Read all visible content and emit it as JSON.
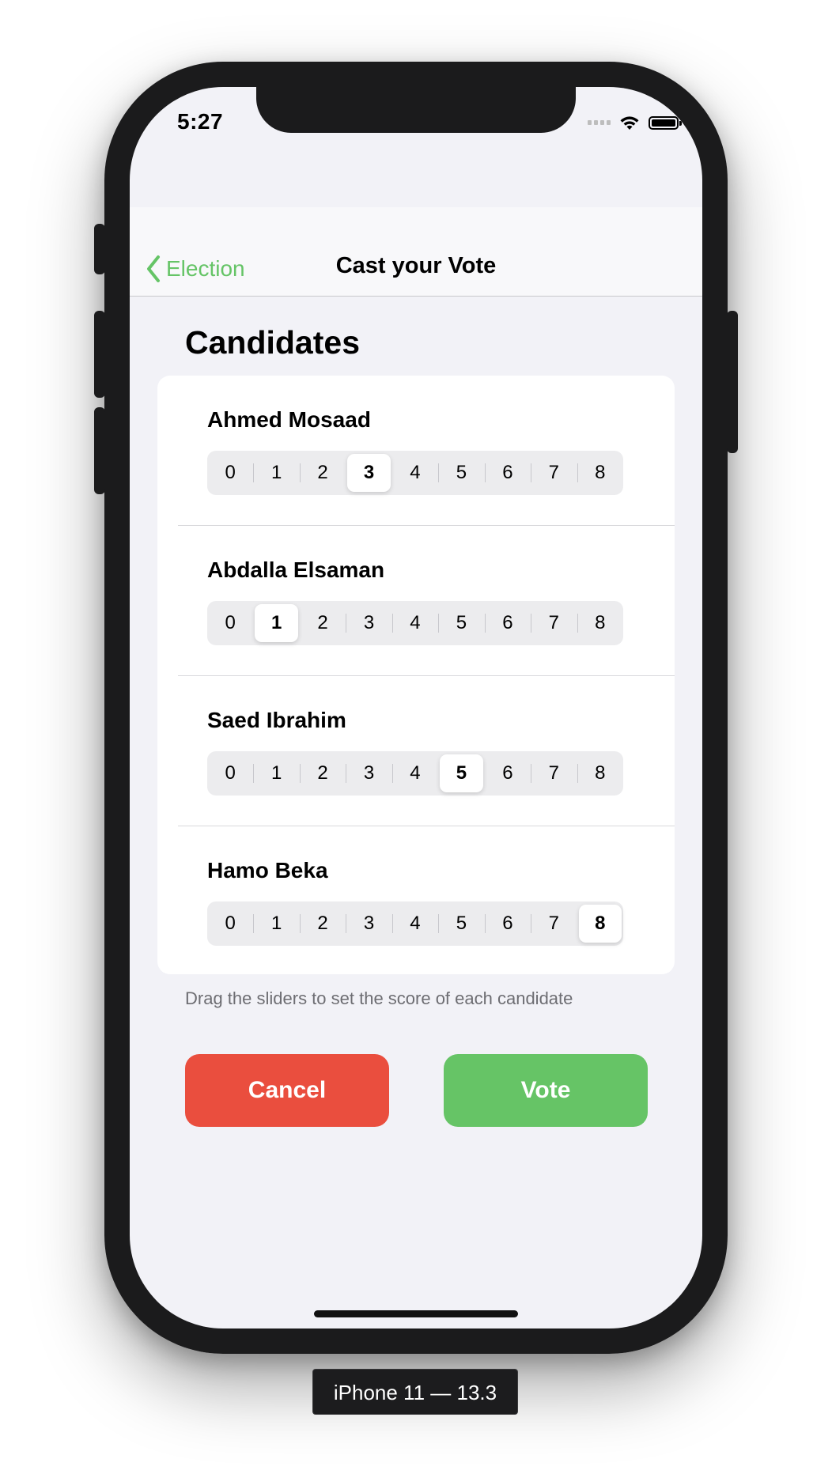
{
  "status_bar": {
    "time": "5:27"
  },
  "nav": {
    "back_label": "Election",
    "title": "Cast your Vote"
  },
  "section_title": "Candidates",
  "candidates": [
    {
      "name": "Ahmed Mosaad",
      "score": 3
    },
    {
      "name": "Abdalla Elsaman",
      "score": 1
    },
    {
      "name": "Saed Ibrahim",
      "score": 5
    },
    {
      "name": "Hamo Beka",
      "score": 8
    }
  ],
  "score_options": [
    "0",
    "1",
    "2",
    "3",
    "4",
    "5",
    "6",
    "7",
    "8"
  ],
  "footer_note": "Drag the sliders to set the score of each candidate",
  "buttons": {
    "cancel_label": "Cancel",
    "vote_label": "Vote"
  },
  "device_label": "iPhone 11 — 13.3",
  "colors": {
    "accent": "#65c466",
    "cancel": "#ea4e3e",
    "vote": "#66c466"
  },
  "icons": {
    "back": "chevron-left-icon",
    "signal": "cellular-signal-icon",
    "wifi": "wifi-icon",
    "battery": "battery-icon"
  }
}
